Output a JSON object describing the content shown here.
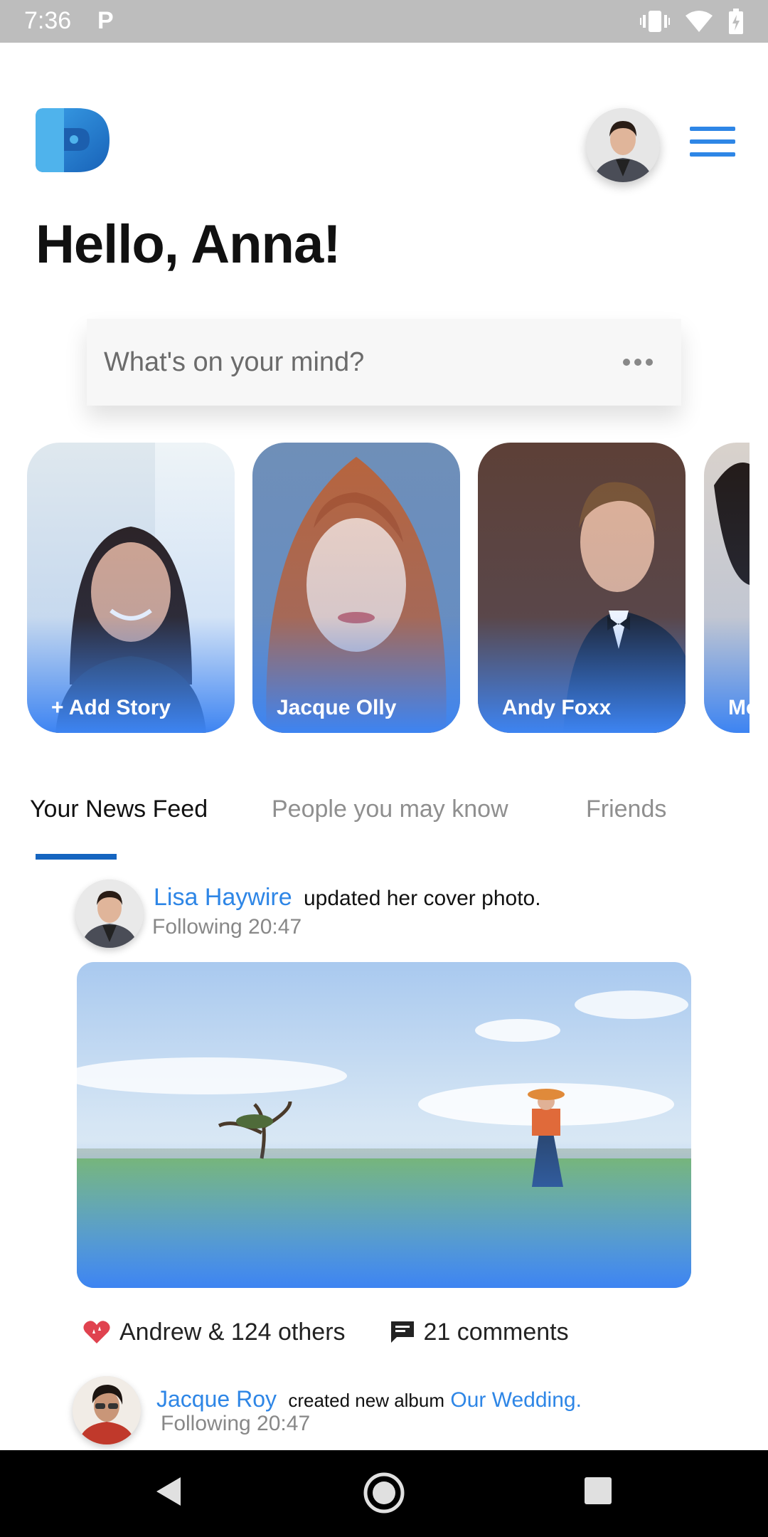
{
  "status": {
    "time": "7:36",
    "app_indicator": "P"
  },
  "header": {
    "greeting": "Hello, Anna!"
  },
  "composer": {
    "placeholder": "What's on your mind?"
  },
  "stories": [
    {
      "label": "+ Add Story"
    },
    {
      "label": "Jacque Olly"
    },
    {
      "label": "Andy Foxx"
    },
    {
      "label": "Mc"
    }
  ],
  "tabs": [
    {
      "label": "Your News Feed",
      "active": true
    },
    {
      "label": "People you may know",
      "active": false
    },
    {
      "label": "Friends",
      "active": false
    }
  ],
  "posts": [
    {
      "name": "Lisa Haywire",
      "action": "updated her cover photo.",
      "meta": "Following  20:47",
      "likes": "Andrew & 124 others",
      "comments": "21 comments"
    },
    {
      "name": "Jacque Roy",
      "action": "created new album",
      "link": "Our Wedding.",
      "meta": "Following  20:47"
    }
  ],
  "colors": {
    "accent": "#2e86e6",
    "tab_indicator": "#1565c0",
    "story_gradient": "#3d84f2"
  }
}
